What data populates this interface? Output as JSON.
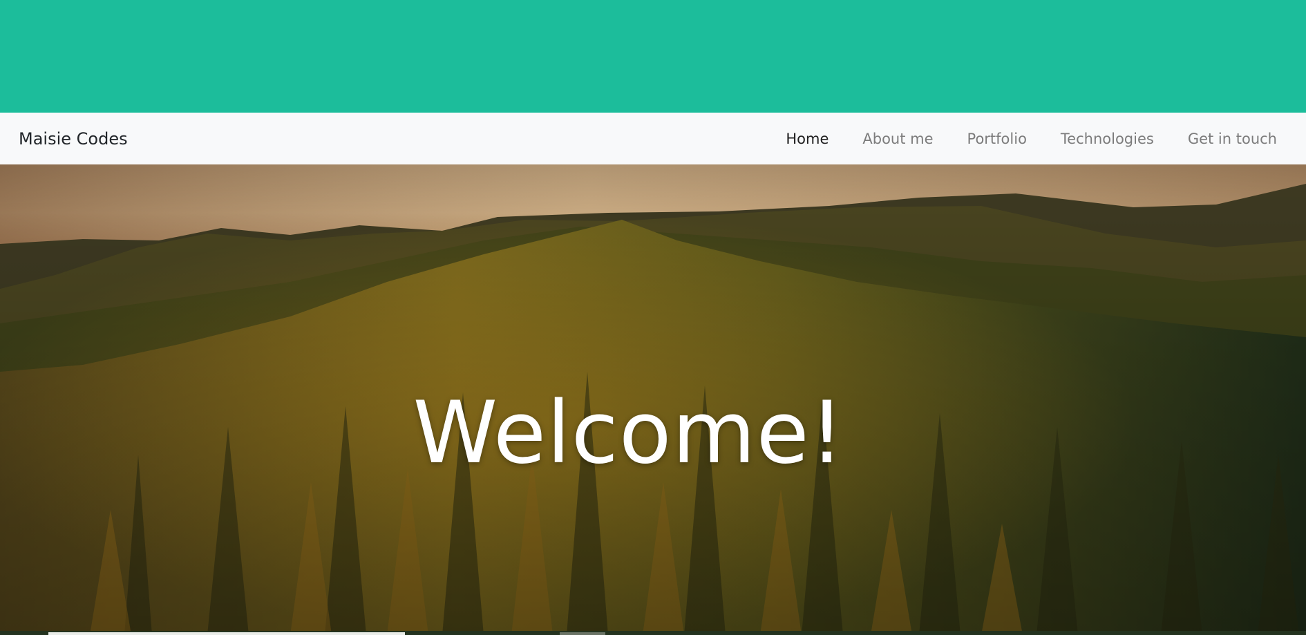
{
  "navbar": {
    "brand": "Maisie Codes",
    "links": [
      {
        "label": "Home",
        "active": true
      },
      {
        "label": "About me",
        "active": false
      },
      {
        "label": "Portfolio",
        "active": false
      },
      {
        "label": "Technologies",
        "active": false
      },
      {
        "label": "Get in touch",
        "active": false
      }
    ]
  },
  "hero": {
    "title": "Welcome!",
    "image": "forest-mountains-sunset"
  },
  "colors": {
    "top_band": "#1cbd9b",
    "navbar_bg": "#f8f9fa",
    "link_active": "#1f1f1f",
    "link_inactive": "#7c7c7c"
  }
}
